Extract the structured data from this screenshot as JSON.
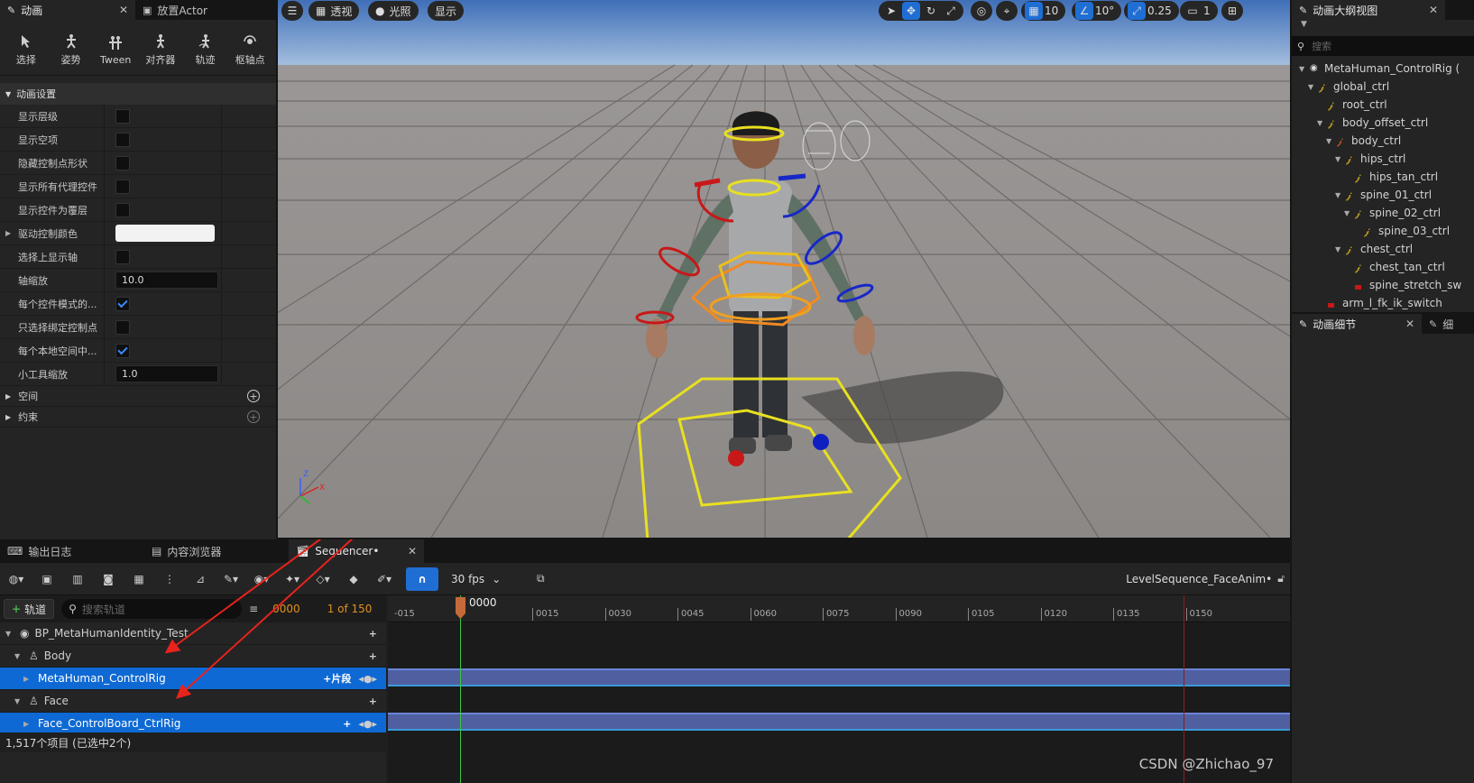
{
  "left_panel": {
    "tab_anim": "动画",
    "tab_place": "放置Actor",
    "tools": [
      {
        "label": "选择",
        "icon": "select-icon"
      },
      {
        "label": "姿势",
        "icon": "pose-icon"
      },
      {
        "label": "Tween",
        "icon": "tween-icon"
      },
      {
        "label": "对齐器",
        "icon": "aligner-icon"
      },
      {
        "label": "轨迹",
        "icon": "trail-icon"
      },
      {
        "label": "枢轴点",
        "icon": "pivot-icon"
      }
    ],
    "section_title": "动画设置",
    "props": [
      {
        "label": "显示层级",
        "type": "check",
        "checked": false
      },
      {
        "label": "显示空项",
        "type": "check",
        "checked": false
      },
      {
        "label": "隐藏控制点形状",
        "type": "check",
        "checked": false
      },
      {
        "label": "显示所有代理控件",
        "type": "check",
        "checked": false
      },
      {
        "label": "显示控件为覆层",
        "type": "check",
        "checked": false
      },
      {
        "label": "驱动控制颜色",
        "type": "color"
      },
      {
        "label": "选择上显示轴",
        "type": "check",
        "checked": false
      },
      {
        "label": "轴缩放",
        "type": "number",
        "value": "10.0"
      },
      {
        "label": "每个控件模式的...",
        "type": "check",
        "checked": true
      },
      {
        "label": "只选择绑定控制点",
        "type": "check",
        "checked": false
      },
      {
        "label": "每个本地空间中...",
        "type": "check",
        "checked": true
      },
      {
        "label": "小工具缩放",
        "type": "number",
        "value": "1.0"
      }
    ],
    "cat_space": "空间",
    "cat_constraint": "约束"
  },
  "viewport": {
    "perspective": "透视",
    "lit": "光照",
    "show": "显示",
    "grid_snap": "10",
    "rot_snap": "10°",
    "scale_snap": "0.25",
    "cam_speed": "1"
  },
  "outliner": {
    "tab": "动画大纲视图",
    "search_placeholder": "搜索",
    "items": [
      {
        "label": "MetaHuman_ControlRig (",
        "depth": 0,
        "arrow": true,
        "kind": "root"
      },
      {
        "label": "global_ctrl",
        "depth": 1,
        "arrow": true,
        "kind": "ctrl"
      },
      {
        "label": "root_ctrl",
        "depth": 2,
        "arrow": false,
        "kind": "ctrl"
      },
      {
        "label": "body_offset_ctrl",
        "depth": 2,
        "arrow": true,
        "kind": "ctrl"
      },
      {
        "label": "body_ctrl",
        "depth": 3,
        "arrow": true,
        "kind": "ctrl-red"
      },
      {
        "label": "hips_ctrl",
        "depth": 4,
        "arrow": true,
        "kind": "ctrl"
      },
      {
        "label": "hips_tan_ctrl",
        "depth": 5,
        "arrow": false,
        "kind": "ctrl"
      },
      {
        "label": "spine_01_ctrl",
        "depth": 4,
        "arrow": true,
        "kind": "ctrl"
      },
      {
        "label": "spine_02_ctrl",
        "depth": 5,
        "arrow": true,
        "kind": "ctrl"
      },
      {
        "label": "spine_03_ctrl",
        "depth": 6,
        "arrow": false,
        "kind": "ctrl"
      },
      {
        "label": "chest_ctrl",
        "depth": 4,
        "arrow": true,
        "kind": "ctrl"
      },
      {
        "label": "chest_tan_ctrl",
        "depth": 5,
        "arrow": false,
        "kind": "ctrl"
      },
      {
        "label": "spine_stretch_sw",
        "depth": 5,
        "arrow": false,
        "kind": "switch"
      },
      {
        "label": "arm_l_fk_ik_switch",
        "depth": 2,
        "arrow": false,
        "kind": "switch"
      }
    ]
  },
  "details": {
    "tab": "动画细节",
    "tab2": "细"
  },
  "bottom": {
    "tab_log": "输出日志",
    "tab_content": "内容浏览器",
    "tab_seq": "Sequencer•",
    "fps": "30 fps",
    "sequence_name": "LevelSequence_FaceAnim•",
    "add_track": "轨道",
    "search_placeholder": "搜索轨道",
    "current_frame": "0000",
    "frame_range": "1 of 150",
    "playhead_label": "0000",
    "ticks": [
      "-015",
      "0015",
      "0030",
      "0045",
      "0060",
      "0075",
      "0090",
      "0105",
      "0120",
      "0135",
      "0150"
    ],
    "tracks": [
      {
        "label": "BP_MetaHumanIdentity_Test",
        "depth": 0,
        "selected": false,
        "right": "+"
      },
      {
        "label": "Body",
        "depth": 1,
        "selected": false,
        "right": "+"
      },
      {
        "label": "MetaHuman_ControlRig",
        "depth": 2,
        "selected": true,
        "right": "+片段"
      },
      {
        "label": "Face",
        "depth": 1,
        "selected": false,
        "right": "+"
      },
      {
        "label": "Face_ControlBoard_CtrlRig",
        "depth": 2,
        "selected": true,
        "right": "+"
      }
    ],
    "status": "1,517个项目 (已选中2个)"
  },
  "watermark": "CSDN @Zhichao_97"
}
